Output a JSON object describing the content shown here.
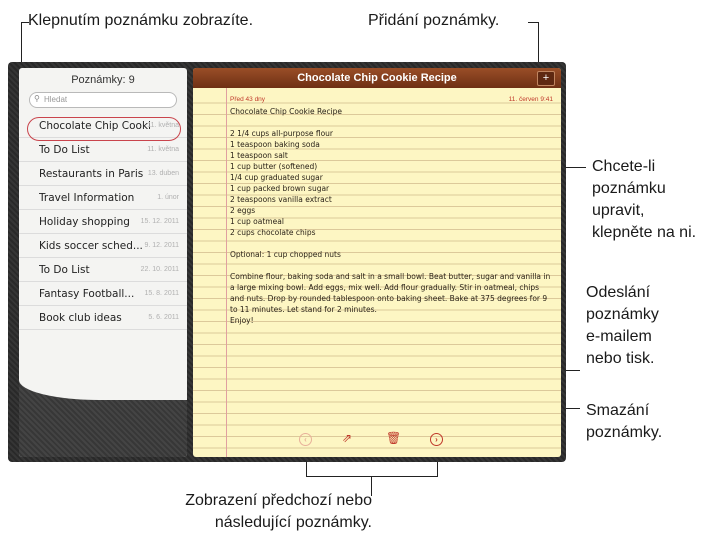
{
  "callouts": {
    "tap_to_view": "Klepnutím poznámku zobrazíte.",
    "add_note": "Přidání poznámky.",
    "edit_line1": "Chcete-li",
    "edit_line2": "poznámku",
    "edit_line3": "upravit,",
    "edit_line4": "klepněte na ni.",
    "send_line1": "Odeslání",
    "send_line2": "poznámky",
    "send_line3": "e-mailem",
    "send_line4": "nebo tisk.",
    "delete_line1": "Smazání",
    "delete_line2": "poznámky.",
    "nav_line1": "Zobrazení předchozí nebo",
    "nav_line2": "následující poznámky."
  },
  "sidebar": {
    "title": "Poznámky: 9",
    "search_placeholder": "Hledat",
    "search_icon": "magnifier-icon",
    "items": [
      {
        "title": "Chocolate Chip Cookie...",
        "date": "11. května"
      },
      {
        "title": "To Do List",
        "date": "11. května"
      },
      {
        "title": "Restaurants in Paris",
        "date": "13. duben"
      },
      {
        "title": "Travel Information",
        "date": "1. únor"
      },
      {
        "title": "Holiday shopping",
        "date": "15. 12. 2011"
      },
      {
        "title": "Kids soccer sched...",
        "date": "9. 12. 2011"
      },
      {
        "title": "To Do List",
        "date": "22. 10. 2011"
      },
      {
        "title": "Fantasy Football...",
        "date": "15. 8. 2011"
      },
      {
        "title": "Book club ideas",
        "date": "5. 6. 2011"
      }
    ]
  },
  "note": {
    "title": "Chocolate Chip Cookie Recipe",
    "add_label": "+",
    "meta_left": "Před 43 dny",
    "meta_right": "11. červen   9:41",
    "body": "Chocolate Chip Cookie Recipe\n\n2 1/4 cups all-purpose flour\n1 teaspoon baking soda\n1 teaspoon salt\n1 cup butter (softened)\n1/4 cup graduated sugar\n1 cup packed brown sugar\n2 teaspoons vanilla extract\n2 eggs\n1 cup oatmeal\n2 cups chocolate chips\n\nOptional: 1 cup chopped nuts\n\nCombine flour, baking soda and salt in a small bowl. Beat butter, sugar and vanilla in a large mixing bowl. Add eggs, mix well. Add flour gradually. Stir in oatmeal, chips and nuts. Drop by rounded tablespoon onto baking sheet. Bake at 375 degrees for 9 to 11 minutes. Let stand for 2 minutes.\nEnjoy!",
    "toolbar": {
      "prev_icon": "previous-arrow-icon",
      "share_icon": "share-icon",
      "trash_icon": "trash-icon",
      "next_icon": "next-arrow-icon"
    }
  },
  "colors": {
    "accent": "#c0392b",
    "note_bar": "#7a3618",
    "paper": "#fdf6c3"
  }
}
